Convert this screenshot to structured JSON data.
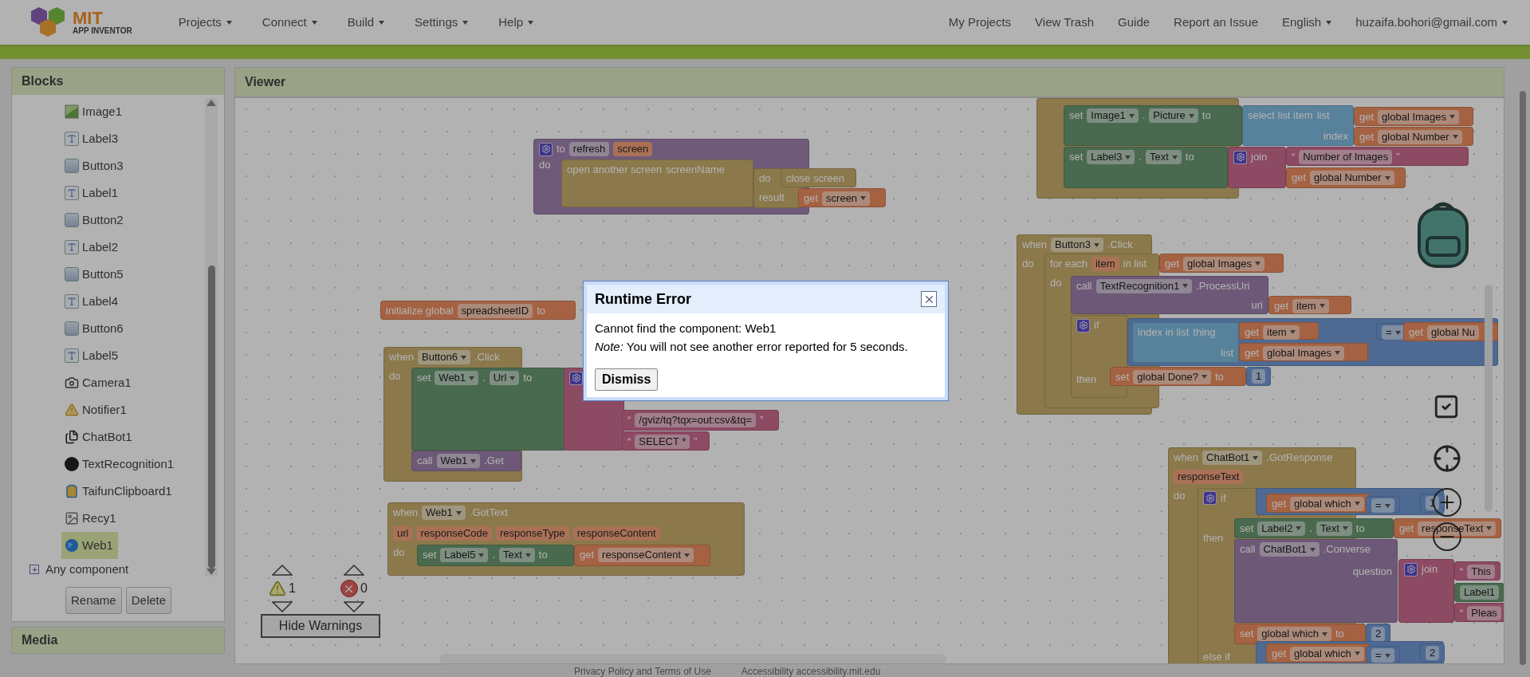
{
  "header": {
    "logo": {
      "title": "MIT",
      "subtitle": "APP INVENTOR"
    },
    "menus": [
      "Projects",
      "Connect",
      "Build",
      "Settings",
      "Help"
    ],
    "links": [
      "My Projects",
      "View Trash",
      "Guide",
      "Report an Issue"
    ],
    "language": "English",
    "account": "huzaifa.bohori@gmail.com"
  },
  "blocks_panel": {
    "title": "Blocks",
    "items": [
      {
        "name": "Image1",
        "kind": "image",
        "selected": false
      },
      {
        "name": "Label3",
        "kind": "label",
        "selected": false
      },
      {
        "name": "Button3",
        "kind": "button",
        "selected": false
      },
      {
        "name": "Label1",
        "kind": "label",
        "selected": false
      },
      {
        "name": "Button2",
        "kind": "button",
        "selected": false
      },
      {
        "name": "Label2",
        "kind": "label",
        "selected": false
      },
      {
        "name": "Button5",
        "kind": "button",
        "selected": false
      },
      {
        "name": "Label4",
        "kind": "label",
        "selected": false
      },
      {
        "name": "Button6",
        "kind": "button",
        "selected": false
      },
      {
        "name": "Label5",
        "kind": "label",
        "selected": false
      },
      {
        "name": "Camera1",
        "kind": "camera",
        "selected": false
      },
      {
        "name": "Notifier1",
        "kind": "notifier",
        "selected": false
      },
      {
        "name": "ChatBot1",
        "kind": "chatbot",
        "selected": false
      },
      {
        "name": "TextRecognition1",
        "kind": "recognizer",
        "selected": false
      },
      {
        "name": "TaifunClipboard1",
        "kind": "extension",
        "selected": false
      },
      {
        "name": "Recy1",
        "kind": "picture",
        "selected": false
      },
      {
        "name": "Web1",
        "kind": "web",
        "selected": true
      }
    ],
    "any_component": "Any component",
    "buttons": [
      "Rename",
      "Delete"
    ]
  },
  "media_panel": {
    "title": "Media"
  },
  "viewer": {
    "title": "Viewer",
    "blocks": [
      {
        "kind": "procedure",
        "rows": [
          [
            {
              "kind": "gear"
            },
            {
              "kind": "label",
              "text": "to"
            },
            {
              "kind": "field",
              "text": "refresh"
            },
            {
              "kind": "param",
              "text": "screen"
            }
          ],
          [
            {
              "kind": "label",
              "text": "do"
            }
          ]
        ]
      },
      {
        "kind": "control",
        "rows": [
          [
            {
              "kind": "label",
              "text": "open another screen"
            },
            {
              "kind": "label",
              "text": "screenName"
            }
          ]
        ]
      },
      {
        "kind": "control",
        "rows": [
          [
            {
              "kind": "label",
              "text": "do"
            }
          ],
          [
            {
              "kind": "label",
              "text": "result"
            }
          ]
        ]
      },
      {
        "kind": "control",
        "rows": [
          [
            {
              "kind": "label",
              "text": "close screen"
            }
          ]
        ]
      },
      {
        "kind": "variable",
        "rows": [
          [
            {
              "kind": "label",
              "text": "get"
            },
            {
              "kind": "dropdown",
              "text": "screen"
            }
          ]
        ]
      },
      {
        "kind": "variable",
        "rows": [
          [
            {
              "kind": "label",
              "text": "initialize global"
            },
            {
              "kind": "field",
              "text": "spreadsheetID"
            },
            {
              "kind": "label",
              "text": "to"
            }
          ]
        ]
      },
      {
        "kind": "event",
        "rows": [
          [
            {
              "kind": "label",
              "text": "when"
            },
            {
              "kind": "dropdown",
              "text": "Button6"
            },
            {
              "kind": "label",
              "text": ".Click"
            }
          ],
          [
            {
              "kind": "label",
              "text": "do"
            }
          ]
        ]
      },
      {
        "kind": "component",
        "rows": [
          [
            {
              "kind": "label",
              "text": "set"
            },
            {
              "kind": "dropdown",
              "text": "Web1"
            },
            {
              "kind": "label",
              "text": "."
            },
            {
              "kind": "dropdown",
              "text": "Url"
            },
            {
              "kind": "label",
              "text": "to"
            }
          ]
        ]
      },
      {
        "kind": "text",
        "rows": [
          [
            {
              "kind": "gear"
            }
          ]
        ]
      },
      {
        "kind": "text",
        "rows": [
          [
            {
              "kind": "label",
              "text": "“"
            },
            {
              "kind": "field",
              "text": "/gviz/tq?tqx=out:csv&tq="
            },
            {
              "kind": "label",
              "text": "”"
            }
          ]
        ]
      },
      {
        "kind": "text",
        "rows": [
          [
            {
              "kind": "label",
              "text": "“"
            },
            {
              "kind": "field",
              "text": "SELECT *"
            },
            {
              "kind": "label",
              "text": "”"
            }
          ]
        ]
      },
      {
        "kind": "call",
        "rows": [
          [
            {
              "kind": "label",
              "text": "call"
            },
            {
              "kind": "dropdown",
              "text": "Web1"
            },
            {
              "kind": "label",
              "text": ".Get"
            }
          ]
        ]
      },
      {
        "kind": "event",
        "rows": [
          [
            {
              "kind": "label",
              "text": "when"
            },
            {
              "kind": "dropdown",
              "text": "Web1"
            },
            {
              "kind": "label",
              "text": ".GotText"
            }
          ],
          [
            {
              "kind": "param",
              "text": "url"
            },
            {
              "kind": "param",
              "text": "responseCode"
            },
            {
              "kind": "param",
              "text": "responseType"
            },
            {
              "kind": "param",
              "text": "responseContent"
            }
          ],
          [
            {
              "kind": "label",
              "text": "do"
            }
          ]
        ]
      },
      {
        "kind": "component",
        "rows": [
          [
            {
              "kind": "label",
              "text": "set"
            },
            {
              "kind": "dropdown",
              "text": "Label5"
            },
            {
              "kind": "label",
              "text": "."
            },
            {
              "kind": "dropdown",
              "text": "Text"
            },
            {
              "kind": "label",
              "text": "to"
            }
          ]
        ]
      },
      {
        "kind": "variable",
        "rows": [
          [
            {
              "kind": "label",
              "text": "get"
            },
            {
              "kind": "dropdown",
              "text": "responseContent"
            }
          ]
        ]
      },
      {
        "kind": "control"
      },
      {
        "kind": "component",
        "rows": [
          [
            {
              "kind": "label",
              "text": "set"
            },
            {
              "kind": "dropdown",
              "text": "Image1"
            },
            {
              "kind": "label",
              "text": "."
            },
            {
              "kind": "dropdown",
              "text": "Picture"
            },
            {
              "kind": "label",
              "text": "to"
            }
          ]
        ]
      },
      {
        "kind": "list",
        "rows": [
          [
            {
              "kind": "label",
              "text": "select list item"
            },
            {
              "kind": "label",
              "text": "list"
            }
          ],
          [
            {
              "kind": "label",
              "text": "index"
            }
          ]
        ]
      },
      {
        "kind": "variable",
        "rows": [
          [
            {
              "kind": "label",
              "text": "get"
            },
            {
              "kind": "dropdown",
              "text": "global Images"
            }
          ]
        ]
      },
      {
        "kind": "variable",
        "rows": [
          [
            {
              "kind": "label",
              "text": "get"
            },
            {
              "kind": "dropdown",
              "text": "global Number"
            }
          ]
        ]
      },
      {
        "kind": "component",
        "rows": [
          [
            {
              "kind": "label",
              "text": "set"
            },
            {
              "kind": "dropdown",
              "text": "Label3"
            },
            {
              "kind": "label",
              "text": "."
            },
            {
              "kind": "dropdown",
              "text": "Text"
            },
            {
              "kind": "label",
              "text": "to"
            }
          ]
        ]
      },
      {
        "kind": "text",
        "rows": [
          [
            {
              "kind": "gear"
            },
            {
              "kind": "label",
              "text": "join"
            }
          ]
        ]
      },
      {
        "kind": "text",
        "rows": [
          [
            {
              "kind": "label",
              "text": "“"
            },
            {
              "kind": "field",
              "text": "Number of Images"
            },
            {
              "kind": "label",
              "text": "”"
            }
          ]
        ]
      },
      {
        "kind": "variable",
        "rows": [
          [
            {
              "kind": "label",
              "text": "get"
            },
            {
              "kind": "dropdown",
              "text": "global Number"
            }
          ]
        ]
      },
      {
        "kind": "event",
        "rows": [
          [
            {
              "kind": "label",
              "text": "when"
            },
            {
              "kind": "dropdown",
              "text": "Button3"
            },
            {
              "kind": "label",
              "text": ".Click"
            }
          ],
          [
            {
              "kind": "label",
              "text": "do"
            }
          ]
        ]
      },
      {
        "kind": "control",
        "rows": [
          [
            {
              "kind": "label",
              "text": "for each"
            },
            {
              "kind": "param",
              "text": "item"
            },
            {
              "kind": "label",
              "text": "in list"
            }
          ],
          [
            {
              "kind": "label",
              "text": "do"
            }
          ]
        ]
      },
      {
        "kind": "variable",
        "rows": [
          [
            {
              "kind": "label",
              "text": "get"
            },
            {
              "kind": "dropdown",
              "text": "global Images"
            }
          ]
        ]
      },
      {
        "kind": "call",
        "rows": [
          [
            {
              "kind": "label",
              "text": "call"
            },
            {
              "kind": "dropdown",
              "text": "TextRecognition1"
            },
            {
              "kind": "label",
              "text": ".ProcessUri"
            }
          ],
          [
            {
              "kind": "label",
              "text": "uri"
            }
          ]
        ]
      },
      {
        "kind": "variable",
        "rows": [
          [
            {
              "kind": "label",
              "text": "get"
            },
            {
              "kind": "dropdown",
              "text": "item"
            }
          ]
        ]
      },
      {
        "kind": "control",
        "rows": [
          [
            {
              "kind": "gear"
            },
            {
              "kind": "label",
              "text": "if"
            }
          ],
          [
            {
              "kind": "label",
              "text": "then"
            }
          ]
        ]
      },
      {
        "kind": "math"
      },
      {
        "kind": "list",
        "rows": [
          [
            {
              "kind": "label",
              "text": "index in list"
            },
            {
              "kind": "label",
              "text": "thing"
            }
          ],
          [
            {
              "kind": "label",
              "text": "list"
            }
          ]
        ]
      },
      {
        "kind": "variable",
        "rows": [
          [
            {
              "kind": "label",
              "text": "get"
            },
            {
              "kind": "dropdown",
              "text": "item"
            }
          ]
        ]
      },
      {
        "kind": "variable",
        "rows": [
          [
            {
              "kind": "label",
              "text": "get"
            },
            {
              "kind": "dropdown",
              "text": "global Images"
            }
          ]
        ]
      },
      {
        "kind": "math",
        "rows": [
          [
            {
              "kind": "dropdown",
              "text": "="
            }
          ]
        ]
      },
      {
        "kind": "variable",
        "rows": [
          [
            {
              "kind": "label",
              "text": "get"
            },
            {
              "kind": "field",
              "text": "global Nu"
            }
          ]
        ]
      },
      {
        "kind": "variable",
        "rows": [
          [
            {
              "kind": "label",
              "text": "set"
            },
            {
              "kind": "dropdown",
              "text": "global Done?"
            },
            {
              "kind": "label",
              "text": "to"
            }
          ]
        ]
      },
      {
        "kind": "math",
        "rows": [
          [
            {
              "kind": "field",
              "text": "1"
            }
          ]
        ]
      },
      {
        "kind": "event",
        "rows": [
          [
            {
              "kind": "label",
              "text": "when"
            },
            {
              "kind": "dropdown",
              "text": "ChatBot1"
            },
            {
              "kind": "label",
              "text": ".GotResponse"
            }
          ],
          [
            {
              "kind": "param",
              "text": "responseText"
            }
          ],
          [
            {
              "kind": "label",
              "text": "do"
            }
          ]
        ]
      },
      {
        "kind": "control",
        "rows": [
          [
            {
              "kind": "gear"
            },
            {
              "kind": "label",
              "text": "if"
            }
          ],
          [
            {
              "kind": "label",
              "text": "then"
            }
          ],
          [
            {
              "kind": "label",
              "text": "else if"
            }
          ]
        ]
      },
      {
        "kind": "math"
      },
      {
        "kind": "variable",
        "rows": [
          [
            {
              "kind": "label",
              "text": "get"
            },
            {
              "kind": "dropdown",
              "text": "global which"
            }
          ]
        ]
      },
      {
        "kind": "math",
        "rows": [
          [
            {
              "kind": "dropdown",
              "text": "="
            }
          ]
        ]
      },
      {
        "kind": "math",
        "rows": [
          [
            {
              "kind": "field",
              "text": "1"
            }
          ]
        ]
      },
      {
        "kind": "component",
        "rows": [
          [
            {
              "kind": "label",
              "text": "set"
            },
            {
              "kind": "dropdown",
              "text": "Label2"
            },
            {
              "kind": "label",
              "text": "."
            },
            {
              "kind": "dropdown",
              "text": "Text"
            },
            {
              "kind": "label",
              "text": "to"
            }
          ]
        ]
      },
      {
        "kind": "variable",
        "rows": [
          [
            {
              "kind": "label",
              "text": "get"
            },
            {
              "kind": "dropdown",
              "text": "responseText"
            }
          ]
        ]
      },
      {
        "kind": "call",
        "rows": [
          [
            {
              "kind": "label",
              "text": "call"
            },
            {
              "kind": "dropdown",
              "text": "ChatBot1"
            },
            {
              "kind": "label",
              "text": ".Converse"
            }
          ],
          [
            {
              "kind": "label",
              "text": "question"
            }
          ]
        ]
      },
      {
        "kind": "text",
        "rows": [
          [
            {
              "kind": "gear"
            },
            {
              "kind": "label",
              "text": "join"
            }
          ]
        ]
      },
      {
        "kind": "text",
        "rows": [
          [
            {
              "kind": "label",
              "text": "“"
            },
            {
              "kind": "field",
              "text": "This"
            }
          ]
        ]
      },
      {
        "kind": "component",
        "rows": [
          [
            {
              "kind": "field",
              "text": "Label1"
            }
          ]
        ]
      },
      {
        "kind": "text",
        "rows": [
          [
            {
              "kind": "label",
              "text": "“"
            },
            {
              "kind": "field",
              "text": "Pleas"
            }
          ]
        ]
      },
      {
        "kind": "variable",
        "rows": [
          [
            {
              "kind": "label",
              "text": "set"
            },
            {
              "kind": "dropdown",
              "text": "global which"
            },
            {
              "kind": "label",
              "text": "to"
            }
          ]
        ]
      },
      {
        "kind": "math",
        "rows": [
          [
            {
              "kind": "field",
              "text": "2"
            }
          ]
        ]
      },
      {
        "kind": "math"
      },
      {
        "kind": "variable",
        "rows": [
          [
            {
              "kind": "label",
              "text": "get"
            },
            {
              "kind": "dropdown",
              "text": "global which"
            }
          ]
        ]
      },
      {
        "kind": "math",
        "rows": [
          [
            {
              "kind": "dropdown",
              "text": "="
            }
          ]
        ]
      },
      {
        "kind": "math",
        "rows": [
          [
            {
              "kind": "field",
              "text": "2"
            }
          ]
        ]
      }
    ],
    "warnings": {
      "warning_count": "1",
      "error_count": "0",
      "toggle": "Hide Warnings"
    }
  },
  "dialog": {
    "title": "Runtime Error",
    "message": "Cannot find the component: Web1",
    "note": "*Note:* You will not see another error reported for 5 seconds.",
    "button": "Dismiss"
  },
  "footer": {
    "links": [
      "Privacy Policy and Terms of Use",
      "Accessibility accessibility.mit.edu"
    ]
  }
}
